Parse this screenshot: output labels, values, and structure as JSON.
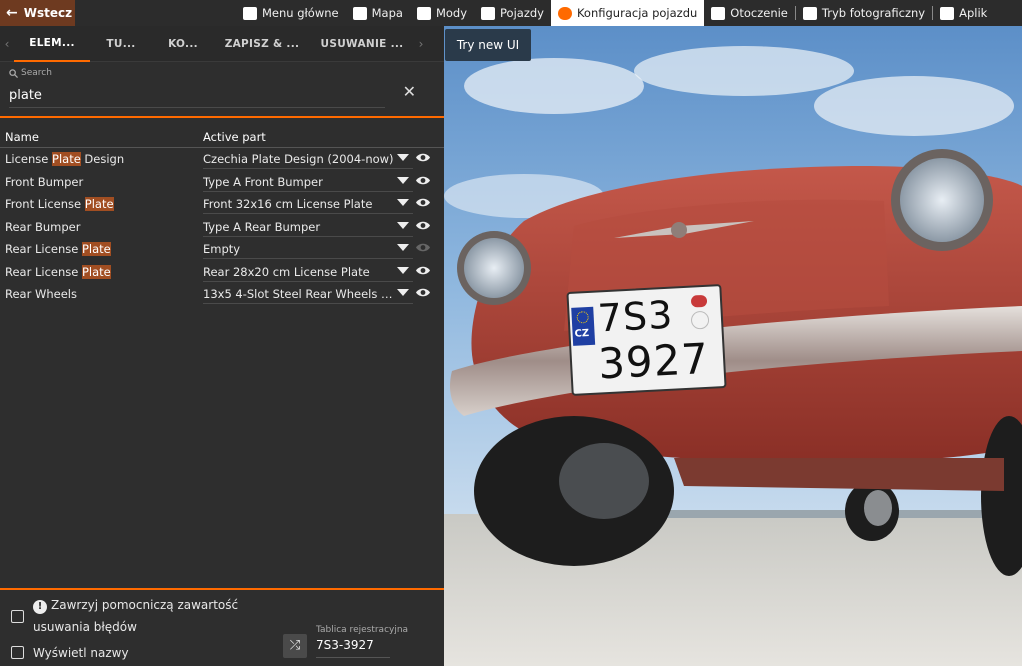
{
  "topbar": {
    "back_label": "Wstecz",
    "items": [
      {
        "label": "Menu główne",
        "icon": "menu-icon"
      },
      {
        "label": "Mapa",
        "icon": "map-icon"
      },
      {
        "label": "Mody",
        "icon": "puzzle-icon"
      },
      {
        "label": "Pojazdy",
        "icon": "car-icon"
      },
      {
        "label": "Konfiguracja pojazdu",
        "icon": "engine-icon",
        "active": true
      },
      {
        "label": "Otoczenie",
        "icon": "weather-icon"
      },
      {
        "label": "Tryb fotograficzny",
        "icon": "camera-icon"
      },
      {
        "label": "Aplik",
        "icon": "apps-icon"
      }
    ]
  },
  "tabs": [
    "ELEM...",
    "TU...",
    "KO...",
    "ZAPISZ & ...",
    "USUWANIE ..."
  ],
  "search": {
    "label": "Search",
    "value": "plate"
  },
  "table": {
    "headers": {
      "name": "Name",
      "part": "Active part"
    },
    "rows": [
      {
        "pre": "License ",
        "hl": "Plate",
        "post": " Design",
        "part": "Czechia Plate Design (2004-now)"
      },
      {
        "pre": "Front Bumper",
        "hl": "",
        "post": "",
        "part": "Type A Front Bumper"
      },
      {
        "pre": "Front License ",
        "hl": "Plate",
        "post": "",
        "part": "Front 32x16 cm License Plate"
      },
      {
        "pre": "Rear Bumper",
        "hl": "",
        "post": "",
        "part": "Type A Rear Bumper"
      },
      {
        "pre": "Rear License ",
        "hl": "Plate",
        "post": "",
        "part": "Empty"
      },
      {
        "pre": "Rear License ",
        "hl": "Plate",
        "post": "",
        "part": "Rear 28x20 cm License Plate"
      },
      {
        "pre": "Rear Wheels",
        "hl": "",
        "post": "",
        "part": "13x5 4-Slot Steel Rear Wheels (..."
      }
    ]
  },
  "footer": {
    "debug_line1": "Zawrzyj pomocniczą zawartość",
    "debug_line2": "usuwania błędów",
    "show_names": "Wyświetl nazwy",
    "plate_label": "Tablica rejestracyjna",
    "plate_value": "7S3-3927"
  },
  "scene": {
    "try_new_ui": "Try new UI",
    "plate_country": "CZ",
    "plate_line1": "7S3",
    "plate_line2": "3927"
  },
  "colors": {
    "accent": "#ff6a00",
    "panel": "#2e2e2e",
    "car": "#b6473a"
  }
}
